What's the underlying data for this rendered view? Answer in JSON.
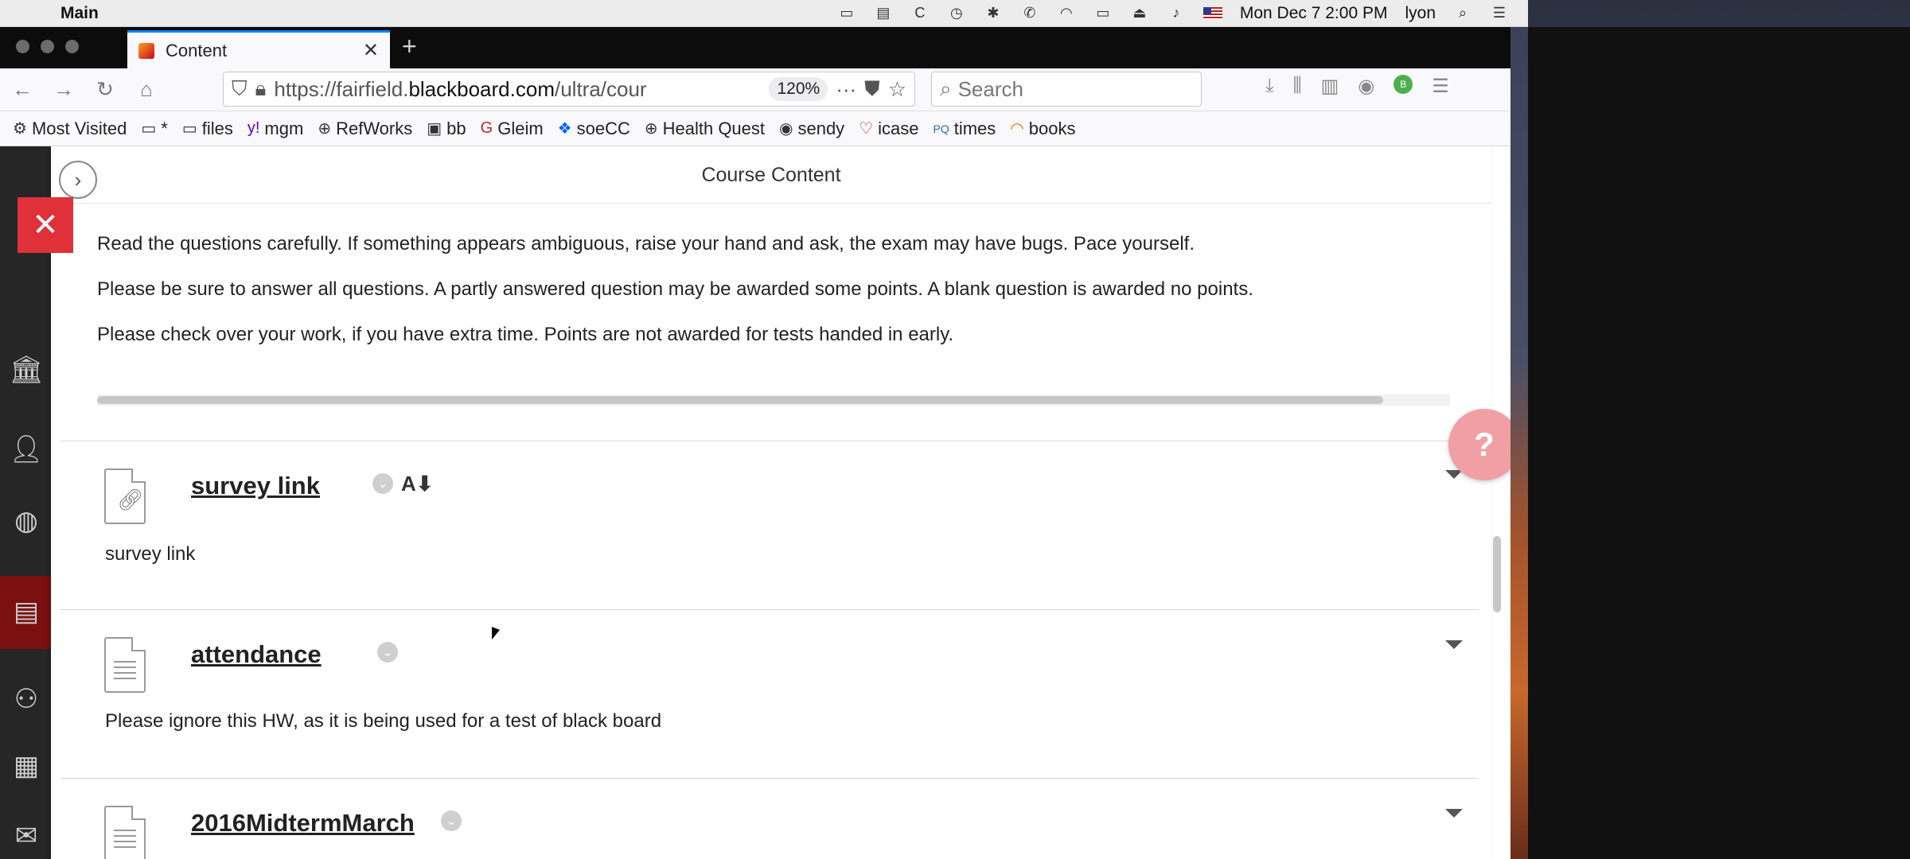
{
  "menubar": {
    "app_name": "Main",
    "datetime": "Mon Dec 7  2:00 PM",
    "user": "lyon"
  },
  "tab": {
    "title": "Content"
  },
  "urlbar": {
    "url_prefix": "https://fairfield.",
    "url_domain": "blackboard.com",
    "url_suffix": "/ultra/cour",
    "zoom": "120%"
  },
  "search": {
    "placeholder": "Search"
  },
  "bookmarks": [
    {
      "label": "Most Visited",
      "icon": "gear-icon"
    },
    {
      "label": "*",
      "icon": "folder-icon"
    },
    {
      "label": "files",
      "icon": "folder-icon"
    },
    {
      "label": "mgm",
      "icon": "yahoo-icon"
    },
    {
      "label": "RefWorks",
      "icon": "globe-icon"
    },
    {
      "label": "bb",
      "icon": "bb-icon"
    },
    {
      "label": "Gleim",
      "icon": "gleim-icon"
    },
    {
      "label": "soeCC",
      "icon": "dropbox-icon"
    },
    {
      "label": "Health Quest",
      "icon": "globe-icon"
    },
    {
      "label": "sendy",
      "icon": "sendy-icon"
    },
    {
      "label": "icase",
      "icon": "icase-icon"
    },
    {
      "label": "times",
      "icon": "pq-icon"
    },
    {
      "label": "books",
      "icon": "books-icon"
    }
  ],
  "panel": {
    "title": "Course Content",
    "instructions": [
      "Read the questions carefully. If something appears ambiguous, raise your hand and ask, the exam may have bugs. Pace yourself.",
      "Please be sure to answer all questions. A partly answered question may be awarded some points. A blank question is awarded no points.",
      "Please check over your work, if you have extra time. Points are not awarded for tests handed in early."
    ]
  },
  "items": [
    {
      "title": "survey link",
      "description": "survey link",
      "type": "link"
    },
    {
      "title": "attendance",
      "description": "Please ignore this HW, as it is being used for a test of black board",
      "type": "document"
    },
    {
      "title": "2016MidtermMarch",
      "description": "",
      "type": "document"
    }
  ],
  "colors": {
    "close_button": "#e0303a",
    "help_button": "#f0a0a4",
    "rail_active": "#7a1010",
    "tab_accent": "#0a84ff"
  }
}
